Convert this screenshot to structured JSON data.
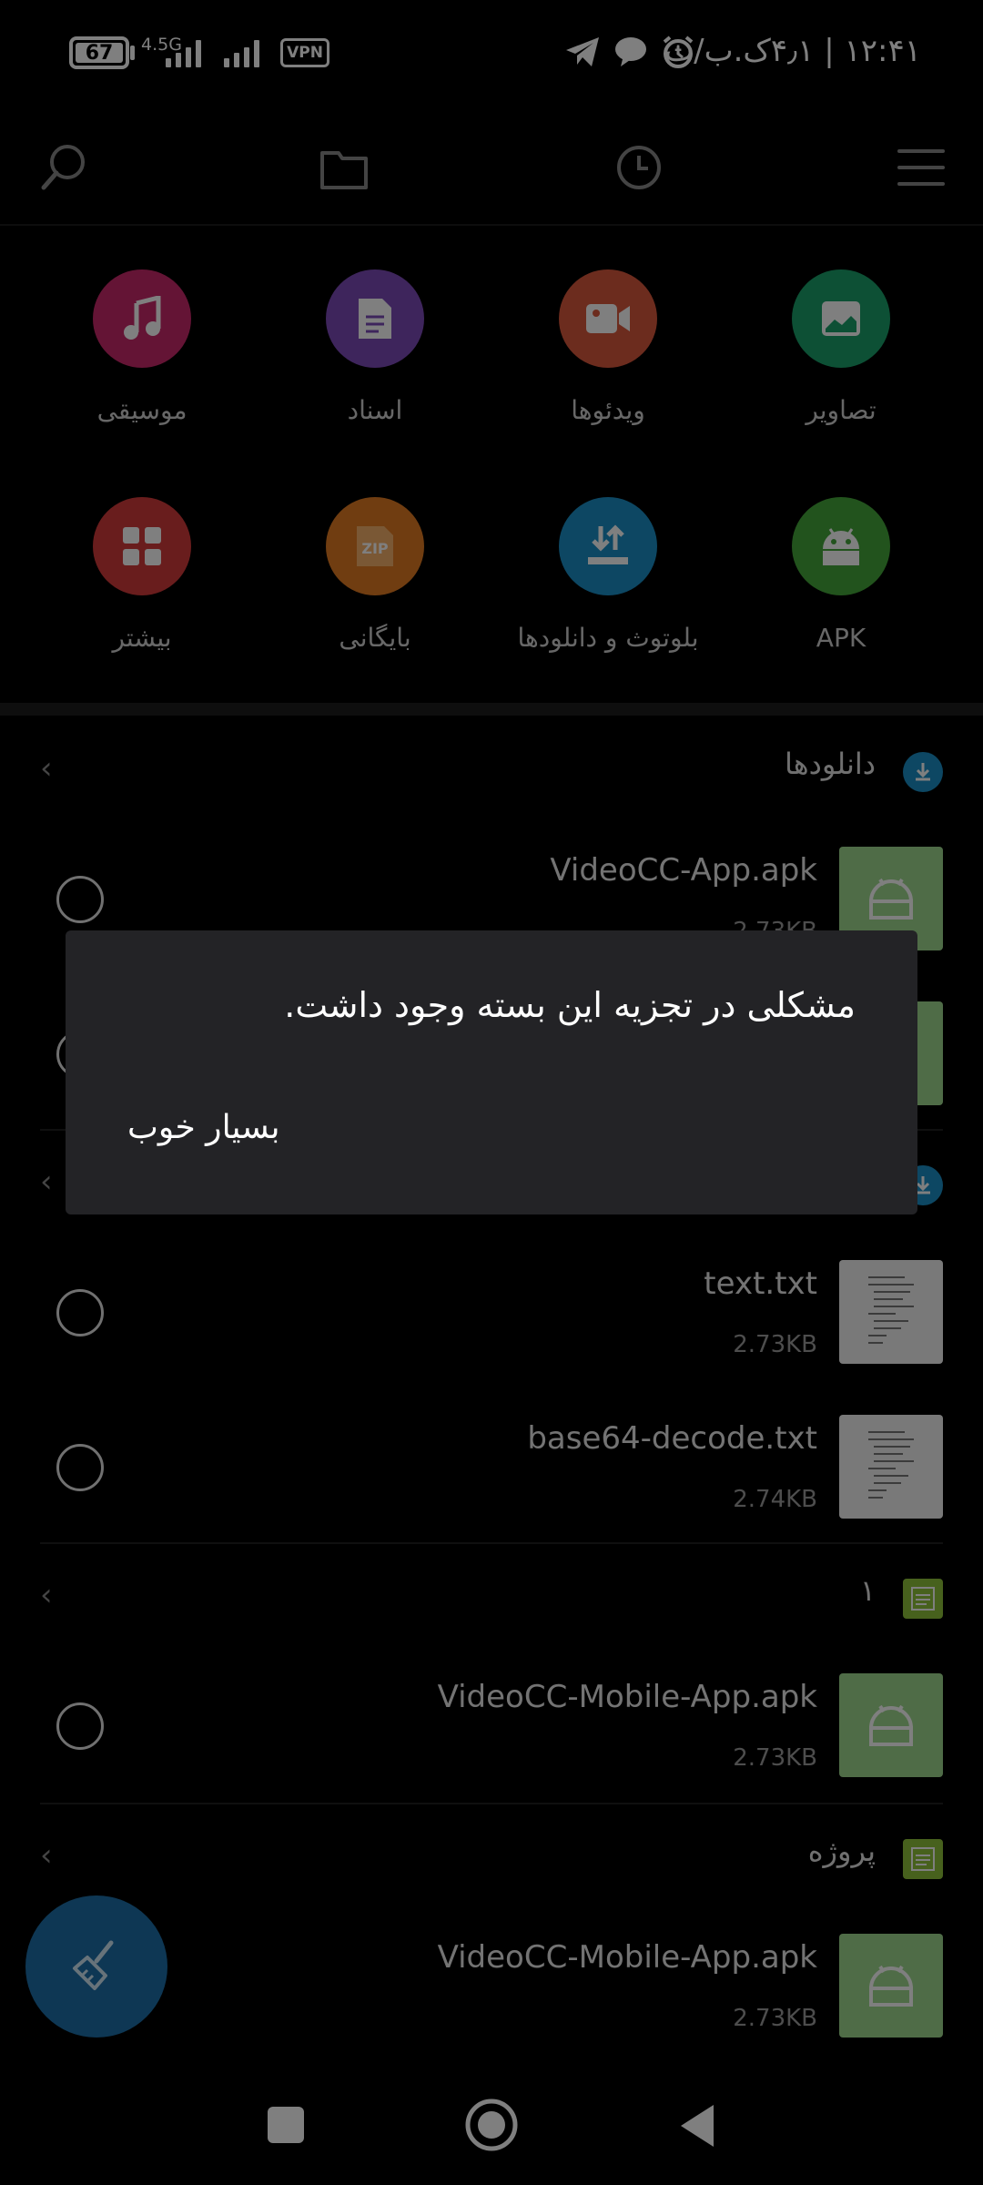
{
  "status_bar": {
    "battery": "67",
    "network": "4.5G",
    "vpn": "VPN",
    "clock": "۱۲:۴۱ | ۴٫۱ک.ب/ث"
  },
  "toolbar": {
    "icons": [
      "search-icon",
      "folder-icon",
      "history-icon",
      "menu-icon"
    ]
  },
  "categories": [
    {
      "label": "تصاویر",
      "icon": "image-icon",
      "color": "#1aa06b"
    },
    {
      "label": "ویدئوها",
      "icon": "video-icon",
      "color": "#d9583d"
    },
    {
      "label": "اسناد",
      "icon": "document-icon",
      "color": "#7d4bb8"
    },
    {
      "label": "موسیقی",
      "icon": "music-icon",
      "color": "#c9286b"
    },
    {
      "label": "APK",
      "icon": "android-icon",
      "color": "#45a63b"
    },
    {
      "label": "بلوتوث و دانلودها",
      "icon": "download-icon",
      "color": "#1a8fc6"
    },
    {
      "label": "بایگانی",
      "icon": "zip-icon",
      "color": "#e07b23"
    },
    {
      "label": "بیشتر",
      "icon": "grid-icon",
      "color": "#d23a3a"
    }
  ],
  "sections": [
    {
      "title": "دانلودها",
      "files": [
        {
          "name": "VideoCC-App.apk",
          "size": "2.73KB",
          "type": "apk"
        },
        {
          "name": "",
          "size": "",
          "type": "apk"
        }
      ]
    },
    {
      "title": "",
      "files": [
        {
          "name": "text.txt",
          "size": "2.73KB",
          "type": "txt"
        },
        {
          "name": "base64-decode.txt",
          "size": "2.74KB",
          "type": "txt"
        }
      ]
    },
    {
      "title": "۱",
      "files": [
        {
          "name": "VideoCC-Mobile-App.apk",
          "size": "2.73KB",
          "type": "apk"
        }
      ]
    },
    {
      "title": "پروژه",
      "files": [
        {
          "name": "VideoCC-Mobile-App.apk",
          "size": "2.73KB",
          "type": "apk"
        }
      ]
    }
  ],
  "dialog": {
    "message": "مشکلی در تجزیه این بسته وجود داشت.",
    "button": "بسیار خوب"
  },
  "colors": {
    "background": "#000000",
    "dialog_bg": "#232326",
    "fab": "#1c6fa8",
    "download_badge": "#1a8fc6",
    "folder_badge": "#8fc23a"
  }
}
